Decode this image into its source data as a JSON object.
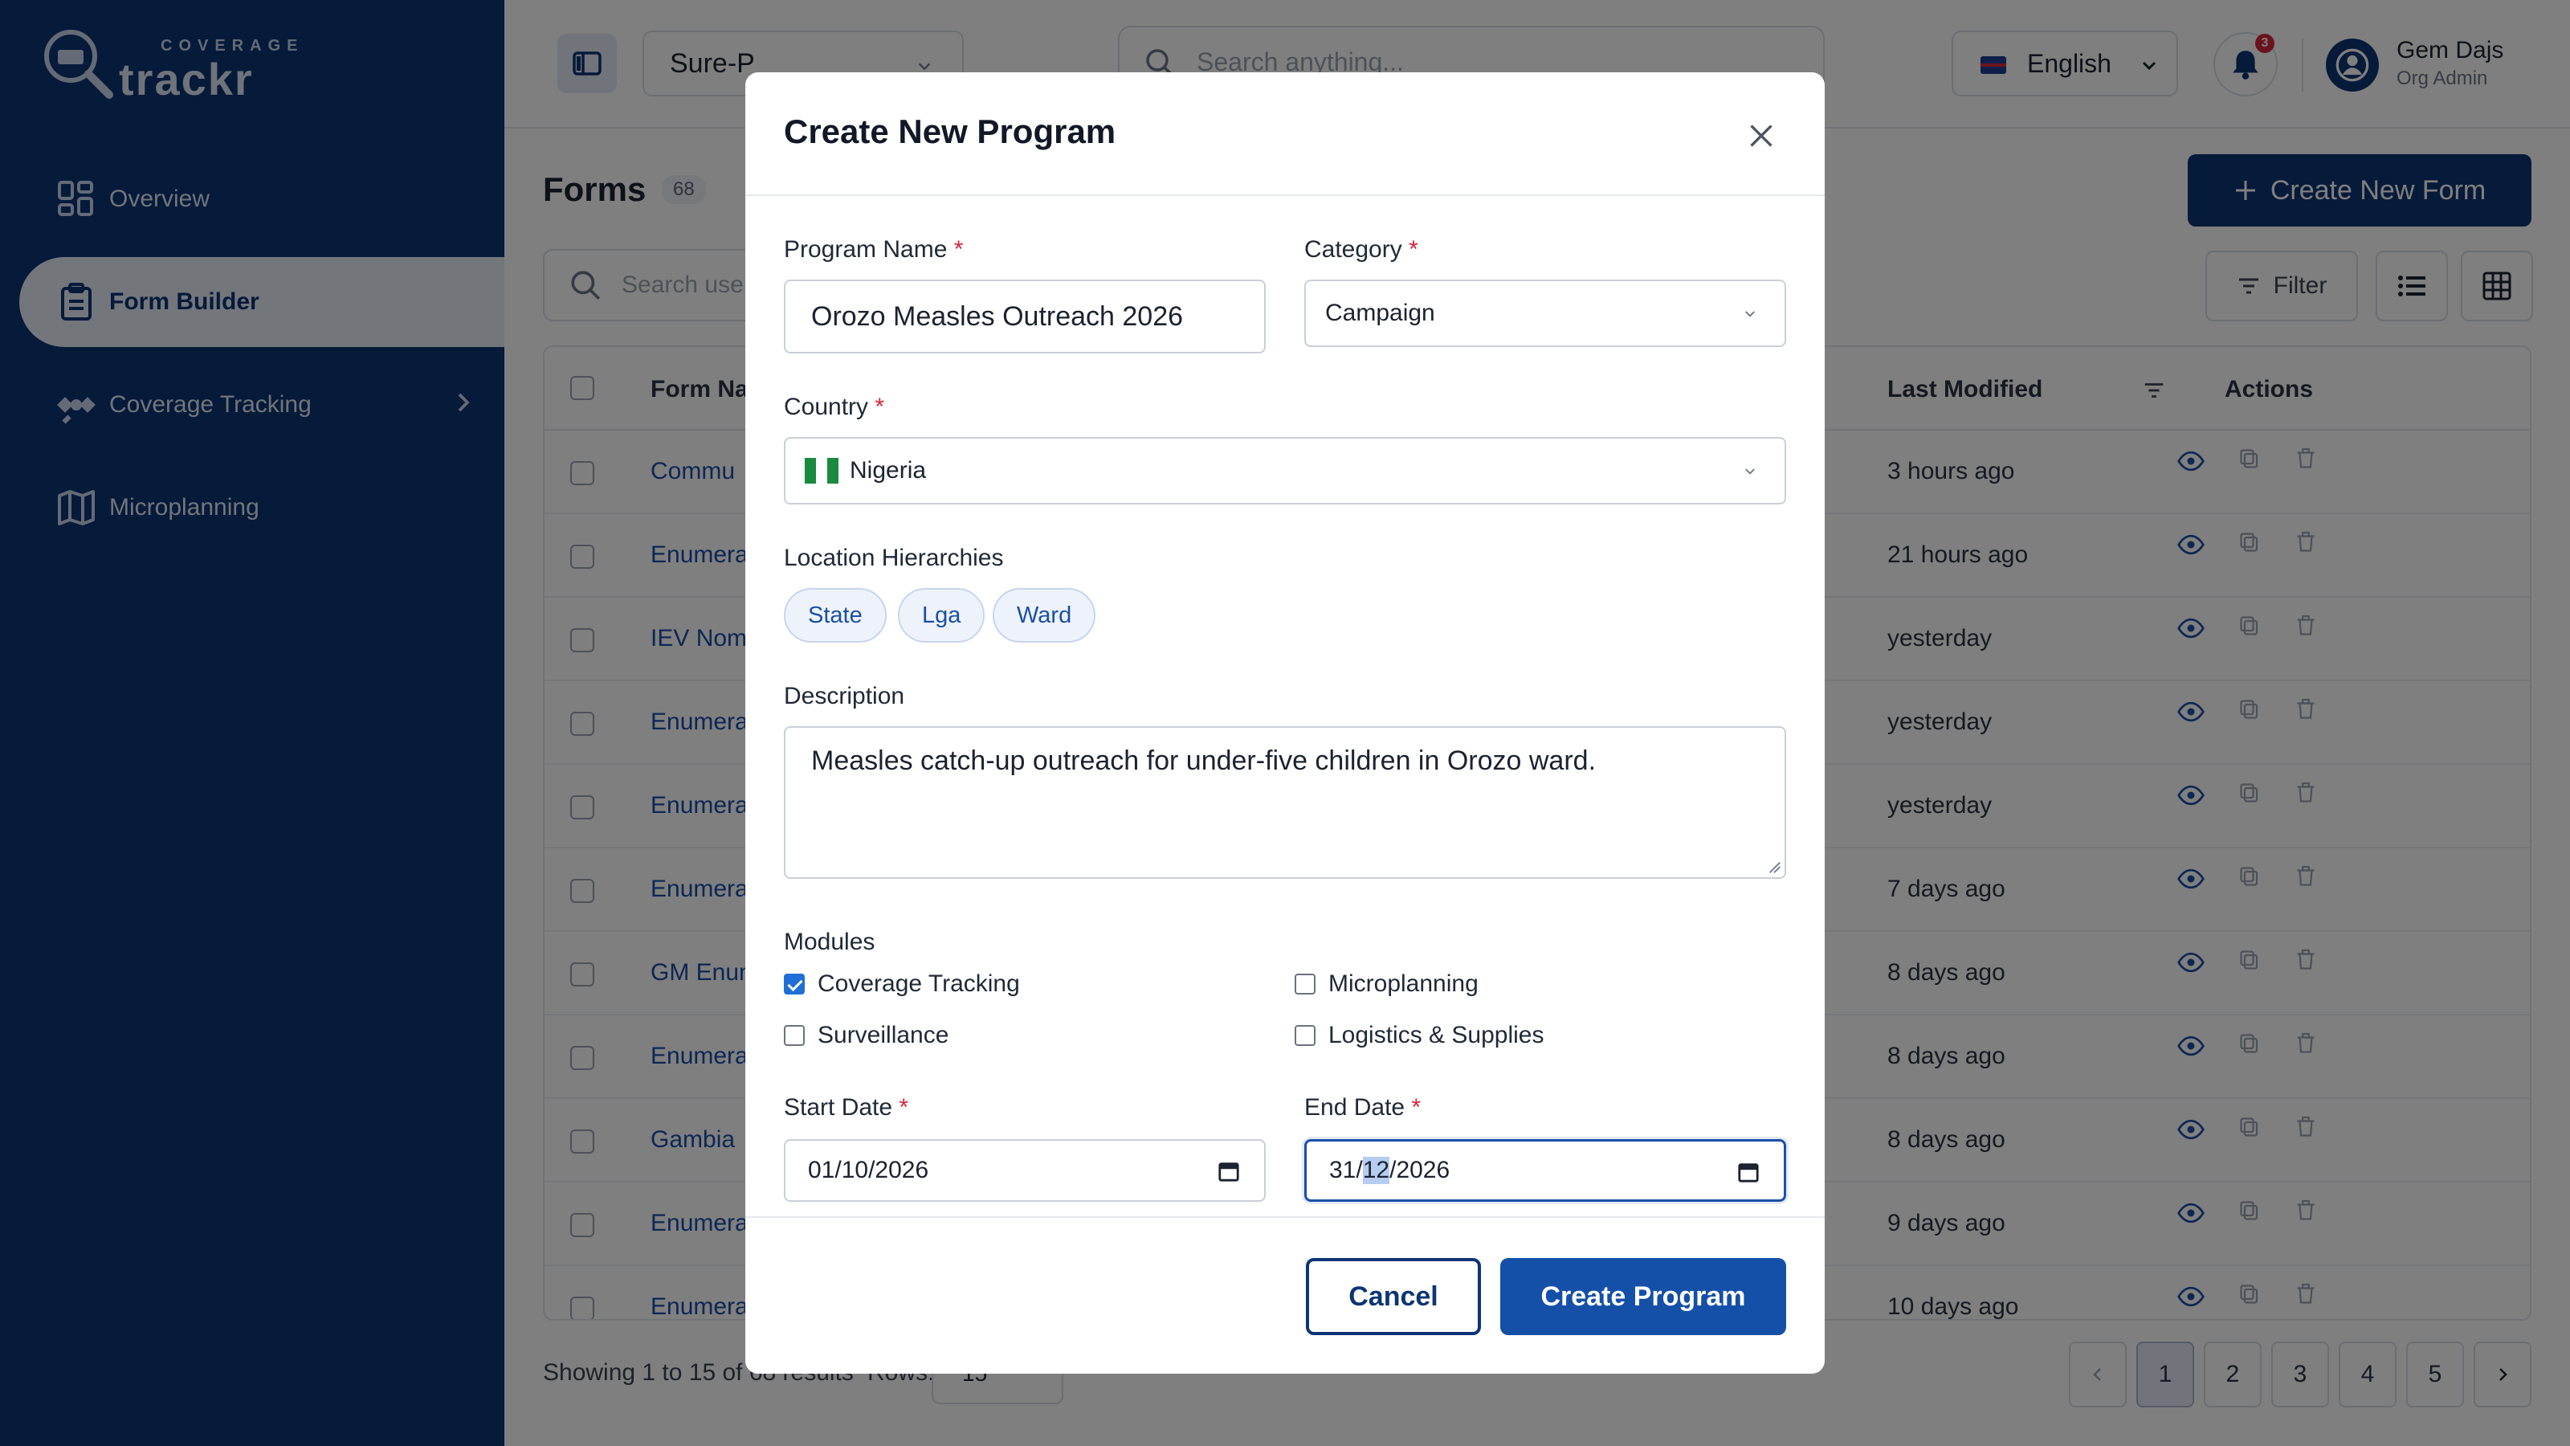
{
  "app": {
    "brand_top": "COVERAGE",
    "brand_name": "trackr"
  },
  "sidebar": {
    "items": [
      {
        "label": "Overview",
        "icon": "overview-icon"
      },
      {
        "label": "Form Builder",
        "icon": "clipboard-icon",
        "active": true
      },
      {
        "label": "Coverage Tracking",
        "icon": "satellite-icon",
        "has_submenu": true
      },
      {
        "label": "Microplanning",
        "icon": "map-icon"
      }
    ]
  },
  "topbar": {
    "program_select": "Sure-P",
    "search_placeholder": "Search anything...",
    "language": "English",
    "notifications_count": "3",
    "user_name": "Gem Dajs",
    "user_role": "Org Admin"
  },
  "forms_page": {
    "title": "Forms",
    "count": "68",
    "create_button": "Create New Form",
    "search_placeholder": "Search use",
    "filter_label": "Filter",
    "columns": {
      "form_name": "Form Na",
      "last_modified": "Last Modified",
      "actions": "Actions"
    },
    "rows": [
      {
        "name": "Commu",
        "modified": "3 hours ago"
      },
      {
        "name": "Enumera",
        "modified": "21 hours ago"
      },
      {
        "name": "IEV Nome",
        "modified": "yesterday"
      },
      {
        "name": "Enumera",
        "modified": "yesterday"
      },
      {
        "name": "Enumera",
        "modified": "yesterday"
      },
      {
        "name": "Enumera",
        "modified": "7 days ago"
      },
      {
        "name": "GM Enum",
        "modified": "8 days ago"
      },
      {
        "name": "Enumera",
        "modified": "8 days ago"
      },
      {
        "name": "Gambia",
        "modified": "8 days ago"
      },
      {
        "name": "Enumera",
        "modified": "9 days ago"
      },
      {
        "name": "Enumera",
        "modified": "10 days ago"
      }
    ],
    "footer_info": "Showing 1 to 15 of 68 results",
    "rows_label": "Rows:",
    "rows_value": "15",
    "pages": [
      "1",
      "2",
      "3",
      "4",
      "5"
    ]
  },
  "modal": {
    "title": "Create New Program",
    "program_name_label": "Program Name",
    "program_name_value": "Orozo Measles Outreach 2026",
    "category_label": "Category",
    "category_value": "Campaign",
    "country_label": "Country",
    "country_value": "Nigeria",
    "location_label": "Location Hierarchies",
    "locations": [
      "State",
      "Lga",
      "Ward"
    ],
    "description_label": "Description",
    "description_value": "Measles catch-up outreach for under-five children in Orozo ward.",
    "modules_label": "Modules",
    "modules": [
      {
        "label": "Coverage Tracking",
        "checked": true
      },
      {
        "label": "Microplanning",
        "checked": false
      },
      {
        "label": "Surveillance",
        "checked": false
      },
      {
        "label": "Logistics & Supplies",
        "checked": false
      }
    ],
    "start_date_label": "Start Date",
    "start_date_value": "01/10/2026",
    "end_date_label": "End Date",
    "end_date_day": "31",
    "end_date_month": "12",
    "end_date_year": "2026",
    "required_mark": "*",
    "cancel_label": "Cancel",
    "create_label": "Create Program"
  }
}
